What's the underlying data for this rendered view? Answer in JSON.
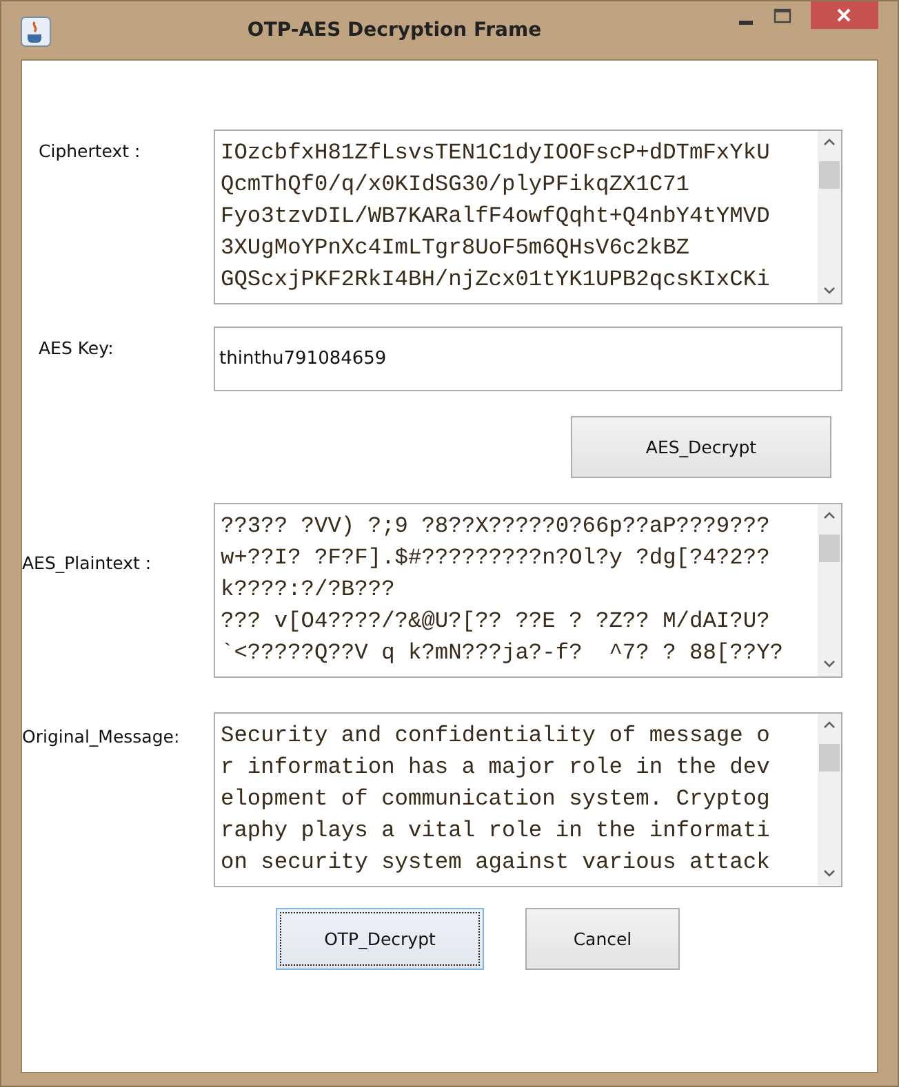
{
  "window": {
    "title": "OTP-AES Decryption Frame"
  },
  "ciphertext": {
    "label": "Ciphertext :",
    "lines": [
      "IOzcbfxH81ZfLsvsTEN1C1dyIOOFscP+dDTmFxYkU",
      "QcmThQf0/q/x0KIdSG30/plyPFikqZX1C71",
      "Fyo3tzvDIL/WB7KARalfF4owfQqht+Q4nbY4tYMVD",
      "3XUgMoYPnXc4ImLTgr8UoF5m6QHsV6c2kBZ",
      "GQScxjPKF2RkI4BH/njZcx01tYK1UPB2qcsKIxCKi"
    ]
  },
  "aes_key": {
    "label": "AES Key:",
    "value": "thinthu791084659"
  },
  "aes_decrypt_button": {
    "label": "AES_Decrypt",
    "focused": false
  },
  "aes_plaintext": {
    "label": "AES_Plaintext :",
    "lines": [
      "??3?? ?VV) ?;9 ?8??X?????0?66p??aP???9???",
      "w+??I? ?F?F].$#?????????n?Ol?y ?dg[?4?2??",
      "k????:?/?B???",
      "??? v[O4????/?&@U?[?? ??E ? ?Z?? M/dAI?U?",
      "`<?????Q??V q k?mN???ja?-f?  ^7? ? 88[??Y?"
    ]
  },
  "original_message": {
    "label": "Original_Message:",
    "lines": [
      "Security and confidentiality of message o",
      "r information has a major role in the dev",
      "elopment of communication system. Cryptog",
      "raphy plays a vital role in the informati",
      "on security system against various attack"
    ]
  },
  "buttons": [
    {
      "label": "OTP_Decrypt",
      "focused": true
    },
    {
      "label": "Cancel",
      "focused": false
    }
  ]
}
